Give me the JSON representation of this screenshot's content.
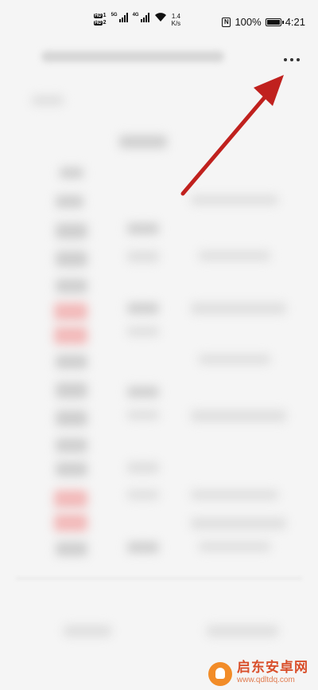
{
  "status_bar": {
    "network_gen_1": "5G",
    "network_gen_2": "4G",
    "speed_value": "1.4",
    "speed_unit": "K/s",
    "battery_percent": "100%",
    "time": "4:21"
  },
  "header": {
    "more_icon": "more-horizontal-icon"
  },
  "annotation": {
    "arrow_color": "#c0211e"
  },
  "watermark": {
    "title": "启东安卓网",
    "url": "www.qdltdq.com"
  }
}
